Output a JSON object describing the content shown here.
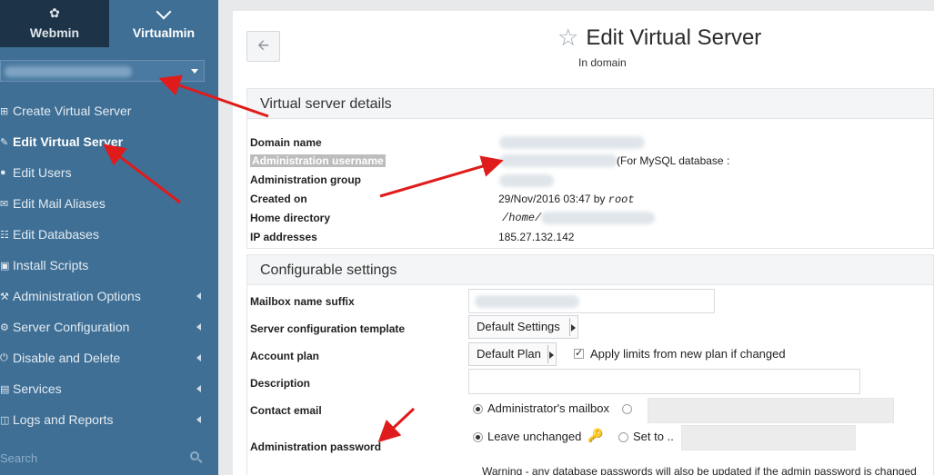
{
  "sidebar": {
    "tabs": [
      {
        "label": "Webmin",
        "icon": "webmin-logo-icon"
      },
      {
        "label": "Virtualmin",
        "icon": "chevron-down-icon"
      }
    ],
    "domain_selector_value": "",
    "items": [
      {
        "label": "Create Virtual Server",
        "icon": "plus-square-icon",
        "submenu": false,
        "active": false
      },
      {
        "label": "Edit Virtual Server",
        "icon": "edit-icon",
        "submenu": false,
        "active": true
      },
      {
        "label": "Edit Users",
        "icon": "users-icon",
        "submenu": false,
        "active": false
      },
      {
        "label": "Edit Mail Aliases",
        "icon": "envelope-icon",
        "submenu": false,
        "active": false
      },
      {
        "label": "Edit Databases",
        "icon": "database-icon",
        "submenu": false,
        "active": false
      },
      {
        "label": "Install Scripts",
        "icon": "archive-icon",
        "submenu": false,
        "active": false
      },
      {
        "label": "Administration Options",
        "icon": "wrench-icon",
        "submenu": true,
        "active": false
      },
      {
        "label": "Server Configuration",
        "icon": "cog-icon",
        "submenu": true,
        "active": false
      },
      {
        "label": "Disable and Delete",
        "icon": "power-icon",
        "submenu": true,
        "active": false
      },
      {
        "label": "Services",
        "icon": "server-icon",
        "submenu": true,
        "active": false
      },
      {
        "label": "Logs and Reports",
        "icon": "file-icon",
        "submenu": true,
        "active": false
      }
    ],
    "search_placeholder": "Search"
  },
  "header": {
    "back_icon": "arrow-left-icon",
    "title": "Edit Virtual Server",
    "subtitle": "In domain"
  },
  "details": {
    "heading": "Virtual server details",
    "rows": [
      {
        "label": "Domain name",
        "value": ""
      },
      {
        "label": "Administration username",
        "value": "",
        "suffix": "(For MySQL database :"
      },
      {
        "label": "Administration group",
        "value": ""
      },
      {
        "label": "Created on",
        "value": "29/Nov/2016 03:47 by",
        "by_user": "root"
      },
      {
        "label": "Home directory",
        "value": "/home/"
      },
      {
        "label": "IP addresses",
        "value": "185.27.132.142"
      }
    ]
  },
  "config": {
    "heading": "Configurable settings",
    "mailbox_suffix": {
      "label": "Mailbox name suffix",
      "value": ""
    },
    "server_template": {
      "label": "Server configuration template",
      "value": "Default Settings"
    },
    "account_plan": {
      "label": "Account plan",
      "value": "Default Plan",
      "checkbox_label": "Apply limits from new plan if changed",
      "checked": true
    },
    "description": {
      "label": "Description",
      "value": ""
    },
    "contact_email": {
      "label": "Contact email",
      "option_admin": "Administrator's mailbox",
      "option_admin_selected": true,
      "other_value": ""
    },
    "admin_password": {
      "label": "Administration password",
      "option_unchanged": "Leave unchanged",
      "option_unchanged_selected": true,
      "option_set": "Set to ..",
      "set_value": ""
    },
    "warning": "Warning - any database passwords will also be updated if the admin password is changed"
  },
  "colors": {
    "sidebar_bg": "#3f6f95",
    "sidebar_dark": "#1d3347",
    "annotation_arrow": "#e01b1b"
  }
}
